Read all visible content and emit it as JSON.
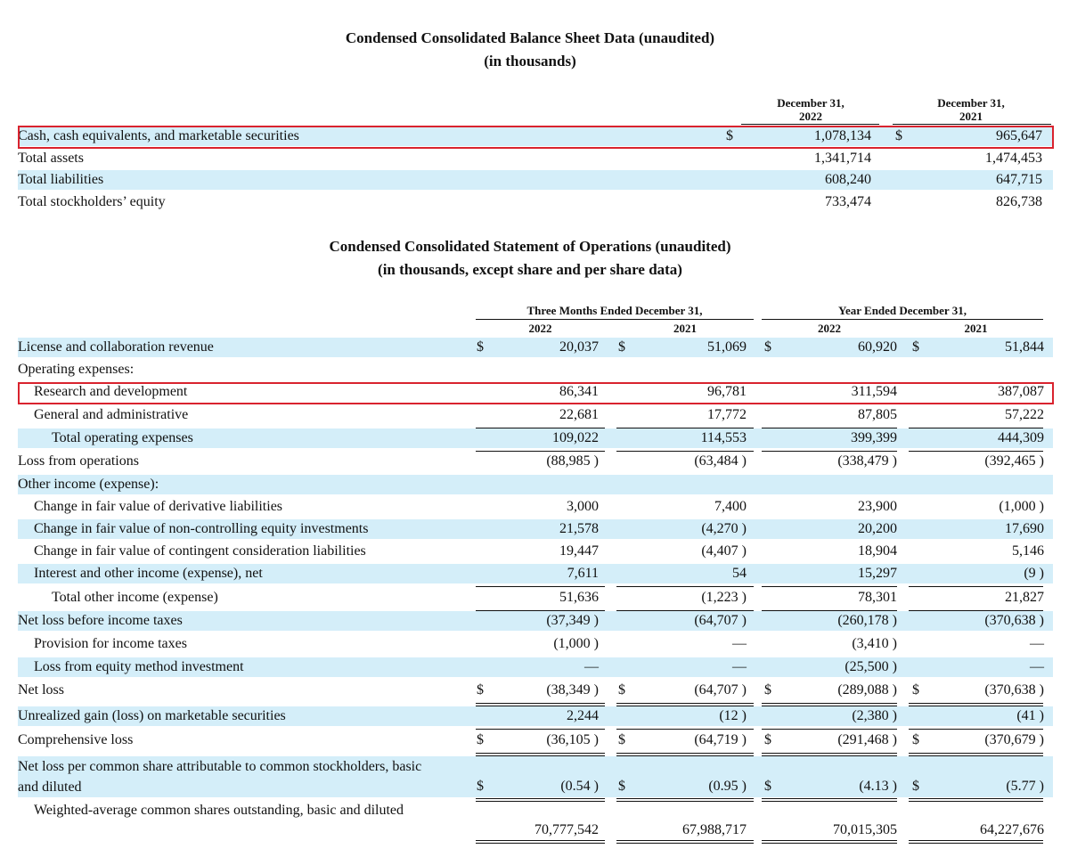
{
  "balance_sheet": {
    "title": "Condensed Consolidated Balance Sheet Data (unaudited)",
    "subtitle": "(in thousands)",
    "columns": [
      {
        "line1": "December 31,",
        "line2": "2022"
      },
      {
        "line1": "December 31,",
        "line2": "2021"
      }
    ],
    "rows": [
      {
        "label": "Cash, cash equivalents, and marketable securities",
        "cur": [
          "$",
          "$"
        ],
        "values": [
          "1,078,134",
          "965,647"
        ]
      },
      {
        "label": "Total assets",
        "cur": [
          "",
          ""
        ],
        "values": [
          "1,341,714",
          "1,474,453"
        ]
      },
      {
        "label": "Total liabilities",
        "cur": [
          "",
          ""
        ],
        "values": [
          "608,240",
          "647,715"
        ]
      },
      {
        "label": "Total stockholders’ equity",
        "cur": [
          "",
          ""
        ],
        "values": [
          "733,474",
          "826,738"
        ]
      }
    ]
  },
  "operations": {
    "title": "Condensed Consolidated Statement of Operations (unaudited)",
    "subtitle": "(in thousands, except share and per share data)",
    "group_headers": [
      "Three Months Ended December 31,",
      "Year Ended December 31,"
    ],
    "year_headers": [
      "2022",
      "2021",
      "2022",
      "2021"
    ],
    "rows": [
      {
        "label": "License and collaboration revenue",
        "cur": [
          "$",
          "$",
          "$",
          "$"
        ],
        "values": [
          "20,037",
          "51,069",
          "60,920",
          "51,844"
        ]
      },
      {
        "label": "Operating expenses:",
        "cur": [
          "",
          "",
          "",
          ""
        ],
        "values": [
          "",
          "",
          "",
          ""
        ]
      },
      {
        "label": "Research and development",
        "cur": [
          "",
          "",
          "",
          ""
        ],
        "values": [
          "86,341",
          "96,781",
          "311,594",
          "387,087"
        ]
      },
      {
        "label": "General and administrative",
        "cur": [
          "",
          "",
          "",
          ""
        ],
        "values": [
          "22,681",
          "17,772",
          "87,805",
          "57,222"
        ]
      },
      {
        "label": "Total operating expenses",
        "cur": [
          "",
          "",
          "",
          ""
        ],
        "values": [
          "109,022",
          "114,553",
          "399,399",
          "444,309"
        ]
      },
      {
        "label": "Loss from operations",
        "cur": [
          "",
          "",
          "",
          ""
        ],
        "values": [
          "(88,985 )",
          "(63,484 )",
          "(338,479 )",
          "(392,465 )"
        ]
      },
      {
        "label": "Other income (expense):",
        "cur": [
          "",
          "",
          "",
          ""
        ],
        "values": [
          "",
          "",
          "",
          ""
        ]
      },
      {
        "label": "Change in fair value of derivative liabilities",
        "cur": [
          "",
          "",
          "",
          ""
        ],
        "values": [
          "3,000",
          "7,400",
          "23,900",
          "(1,000 )"
        ]
      },
      {
        "label": "Change in fair value of non-controlling equity investments",
        "cur": [
          "",
          "",
          "",
          ""
        ],
        "values": [
          "21,578",
          "(4,270 )",
          "20,200",
          "17,690"
        ]
      },
      {
        "label": "Change in fair value of contingent consideration liabilities",
        "cur": [
          "",
          "",
          "",
          ""
        ],
        "values": [
          "19,447",
          "(4,407 )",
          "18,904",
          "5,146"
        ]
      },
      {
        "label": "Interest and other income (expense), net",
        "cur": [
          "",
          "",
          "",
          ""
        ],
        "values": [
          "7,611",
          "54",
          "15,297",
          "(9 )"
        ]
      },
      {
        "label": "Total other income (expense)",
        "cur": [
          "",
          "",
          "",
          ""
        ],
        "values": [
          "51,636",
          "(1,223 )",
          "78,301",
          "21,827"
        ]
      },
      {
        "label": "Net loss before income taxes",
        "cur": [
          "",
          "",
          "",
          ""
        ],
        "values": [
          "(37,349 )",
          "(64,707 )",
          "(260,178 )",
          "(370,638 )"
        ]
      },
      {
        "label": "Provision for income taxes",
        "cur": [
          "",
          "",
          "",
          ""
        ],
        "values": [
          "(1,000 )",
          "—",
          "(3,410 )",
          "—"
        ]
      },
      {
        "label": "Loss from equity method investment",
        "cur": [
          "",
          "",
          "",
          ""
        ],
        "values": [
          "—",
          "—",
          "(25,500 )",
          "—"
        ]
      },
      {
        "label": "Net loss",
        "cur": [
          "$",
          "$",
          "$",
          "$"
        ],
        "values": [
          "(38,349 )",
          "(64,707 )",
          "(289,088 )",
          "(370,638 )"
        ]
      },
      {
        "label": "Unrealized gain (loss) on marketable securities",
        "cur": [
          "",
          "",
          "",
          ""
        ],
        "values": [
          "2,244",
          "(12 )",
          "(2,380 )",
          "(41 )"
        ]
      },
      {
        "label": "Comprehensive loss",
        "cur": [
          "$",
          "$",
          "$",
          "$"
        ],
        "values": [
          "(36,105 )",
          "(64,719 )",
          "(291,468 )",
          "(370,679 )"
        ]
      },
      {
        "label": "Net loss per common share attributable to common stockholders, basic and diluted",
        "cur": [
          "$",
          "$",
          "$",
          "$"
        ],
        "values": [
          "(0.54 )",
          "(0.95 )",
          "(4.13 )",
          "(5.77 )"
        ]
      },
      {
        "label": "Weighted-average common shares outstanding, basic and diluted",
        "cur": [
          "",
          "",
          "",
          ""
        ],
        "values": [
          "70,777,542",
          "67,988,717",
          "70,015,305",
          "64,227,676"
        ]
      }
    ]
  },
  "highlight_color": "#d9232e",
  "row_shade_color": "#d4eef9"
}
